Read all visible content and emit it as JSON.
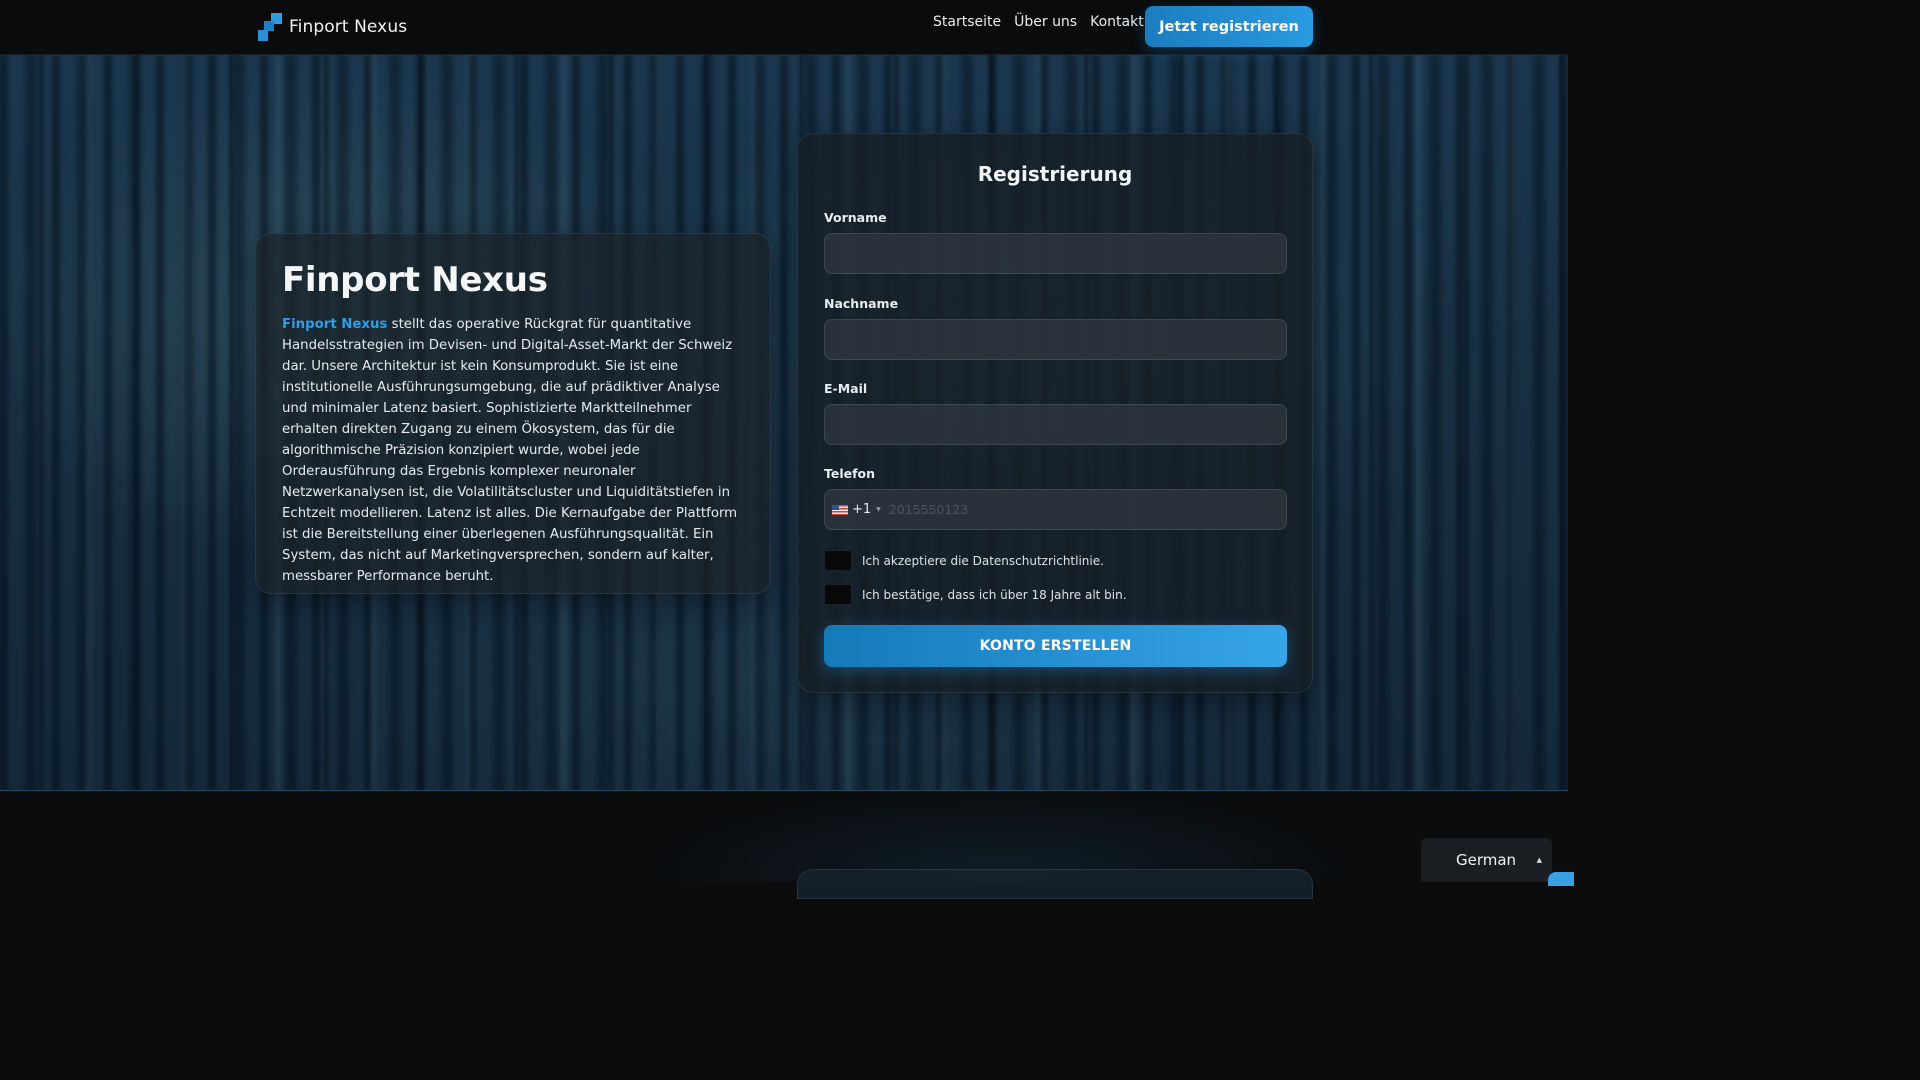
{
  "header": {
    "brand_name": "Finport Nexus",
    "nav": [
      "Startseite",
      "Über uns",
      "Kontakt"
    ],
    "cta_label": "Jetzt registrieren"
  },
  "intro": {
    "title": "Finport Nexus",
    "highlight": "Finport Nexus",
    "body": " stellt das operative Rückgrat für quantitative Handelsstrategien im Devisen- und Digital-Asset-Markt der Schweiz dar. Unsere Architektur ist kein Konsumprodukt. Sie ist eine institutionelle Ausführungsumgebung, die auf prädiktiver Analyse und minimaler Latenz basiert. Sophistizierte Marktteilnehmer erhalten direkten Zugang zu einem Ökosystem, das für die algorithmische Präzision konzipiert wurde, wobei jede Orderausführung das Ergebnis komplexer neuronaler Netzwerkanalysen ist, die Volatilitätscluster und Liquiditätstiefen in Echtzeit modellieren. Latenz ist alles. Die Kernaufgabe der Plattform ist die Bereitstellung einer überlegenen Ausführungsqualität. Ein System, das nicht auf Marketingversprechen, sondern auf kalter, messbarer Performance beruht."
  },
  "form": {
    "title": "Registrierung",
    "first_name_label": "Vorname",
    "first_name_value": "",
    "last_name_label": "Nachname",
    "last_name_value": "",
    "email_label": "E-Mail",
    "email_value": "",
    "phone_label": "Telefon",
    "phone_country": "us-flag-icon",
    "phone_dial_code": "+1",
    "phone_placeholder": "2015550123",
    "privacy_check": "Ich akzeptiere die Datenschutzrichtlinie.",
    "age_check": "Ich bestätige, dass ich über 18 Jahre alt bin.",
    "submit_label": "KONTO ERSTELLEN"
  },
  "language": {
    "selected": "German",
    "caret": "▲"
  },
  "colors": {
    "accent": "#2a9ae0",
    "highlight_text": "#2d9ee8",
    "background": "#0a0c0e"
  }
}
